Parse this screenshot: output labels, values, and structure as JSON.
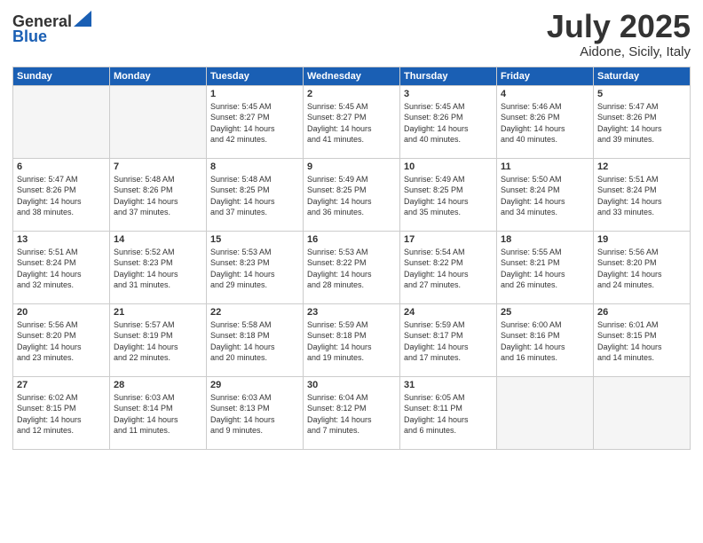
{
  "header": {
    "logo_general": "General",
    "logo_blue": "Blue",
    "month": "July 2025",
    "location": "Aidone, Sicily, Italy"
  },
  "weekdays": [
    "Sunday",
    "Monday",
    "Tuesday",
    "Wednesday",
    "Thursday",
    "Friday",
    "Saturday"
  ],
  "weeks": [
    [
      {
        "day": "",
        "detail": ""
      },
      {
        "day": "",
        "detail": ""
      },
      {
        "day": "1",
        "detail": "Sunrise: 5:45 AM\nSunset: 8:27 PM\nDaylight: 14 hours\nand 42 minutes."
      },
      {
        "day": "2",
        "detail": "Sunrise: 5:45 AM\nSunset: 8:27 PM\nDaylight: 14 hours\nand 41 minutes."
      },
      {
        "day": "3",
        "detail": "Sunrise: 5:45 AM\nSunset: 8:26 PM\nDaylight: 14 hours\nand 40 minutes."
      },
      {
        "day": "4",
        "detail": "Sunrise: 5:46 AM\nSunset: 8:26 PM\nDaylight: 14 hours\nand 40 minutes."
      },
      {
        "day": "5",
        "detail": "Sunrise: 5:47 AM\nSunset: 8:26 PM\nDaylight: 14 hours\nand 39 minutes."
      }
    ],
    [
      {
        "day": "6",
        "detail": "Sunrise: 5:47 AM\nSunset: 8:26 PM\nDaylight: 14 hours\nand 38 minutes."
      },
      {
        "day": "7",
        "detail": "Sunrise: 5:48 AM\nSunset: 8:26 PM\nDaylight: 14 hours\nand 37 minutes."
      },
      {
        "day": "8",
        "detail": "Sunrise: 5:48 AM\nSunset: 8:25 PM\nDaylight: 14 hours\nand 37 minutes."
      },
      {
        "day": "9",
        "detail": "Sunrise: 5:49 AM\nSunset: 8:25 PM\nDaylight: 14 hours\nand 36 minutes."
      },
      {
        "day": "10",
        "detail": "Sunrise: 5:49 AM\nSunset: 8:25 PM\nDaylight: 14 hours\nand 35 minutes."
      },
      {
        "day": "11",
        "detail": "Sunrise: 5:50 AM\nSunset: 8:24 PM\nDaylight: 14 hours\nand 34 minutes."
      },
      {
        "day": "12",
        "detail": "Sunrise: 5:51 AM\nSunset: 8:24 PM\nDaylight: 14 hours\nand 33 minutes."
      }
    ],
    [
      {
        "day": "13",
        "detail": "Sunrise: 5:51 AM\nSunset: 8:24 PM\nDaylight: 14 hours\nand 32 minutes."
      },
      {
        "day": "14",
        "detail": "Sunrise: 5:52 AM\nSunset: 8:23 PM\nDaylight: 14 hours\nand 31 minutes."
      },
      {
        "day": "15",
        "detail": "Sunrise: 5:53 AM\nSunset: 8:23 PM\nDaylight: 14 hours\nand 29 minutes."
      },
      {
        "day": "16",
        "detail": "Sunrise: 5:53 AM\nSunset: 8:22 PM\nDaylight: 14 hours\nand 28 minutes."
      },
      {
        "day": "17",
        "detail": "Sunrise: 5:54 AM\nSunset: 8:22 PM\nDaylight: 14 hours\nand 27 minutes."
      },
      {
        "day": "18",
        "detail": "Sunrise: 5:55 AM\nSunset: 8:21 PM\nDaylight: 14 hours\nand 26 minutes."
      },
      {
        "day": "19",
        "detail": "Sunrise: 5:56 AM\nSunset: 8:20 PM\nDaylight: 14 hours\nand 24 minutes."
      }
    ],
    [
      {
        "day": "20",
        "detail": "Sunrise: 5:56 AM\nSunset: 8:20 PM\nDaylight: 14 hours\nand 23 minutes."
      },
      {
        "day": "21",
        "detail": "Sunrise: 5:57 AM\nSunset: 8:19 PM\nDaylight: 14 hours\nand 22 minutes."
      },
      {
        "day": "22",
        "detail": "Sunrise: 5:58 AM\nSunset: 8:18 PM\nDaylight: 14 hours\nand 20 minutes."
      },
      {
        "day": "23",
        "detail": "Sunrise: 5:59 AM\nSunset: 8:18 PM\nDaylight: 14 hours\nand 19 minutes."
      },
      {
        "day": "24",
        "detail": "Sunrise: 5:59 AM\nSunset: 8:17 PM\nDaylight: 14 hours\nand 17 minutes."
      },
      {
        "day": "25",
        "detail": "Sunrise: 6:00 AM\nSunset: 8:16 PM\nDaylight: 14 hours\nand 16 minutes."
      },
      {
        "day": "26",
        "detail": "Sunrise: 6:01 AM\nSunset: 8:15 PM\nDaylight: 14 hours\nand 14 minutes."
      }
    ],
    [
      {
        "day": "27",
        "detail": "Sunrise: 6:02 AM\nSunset: 8:15 PM\nDaylight: 14 hours\nand 12 minutes."
      },
      {
        "day": "28",
        "detail": "Sunrise: 6:03 AM\nSunset: 8:14 PM\nDaylight: 14 hours\nand 11 minutes."
      },
      {
        "day": "29",
        "detail": "Sunrise: 6:03 AM\nSunset: 8:13 PM\nDaylight: 14 hours\nand 9 minutes."
      },
      {
        "day": "30",
        "detail": "Sunrise: 6:04 AM\nSunset: 8:12 PM\nDaylight: 14 hours\nand 7 minutes."
      },
      {
        "day": "31",
        "detail": "Sunrise: 6:05 AM\nSunset: 8:11 PM\nDaylight: 14 hours\nand 6 minutes."
      },
      {
        "day": "",
        "detail": ""
      },
      {
        "day": "",
        "detail": ""
      }
    ]
  ]
}
